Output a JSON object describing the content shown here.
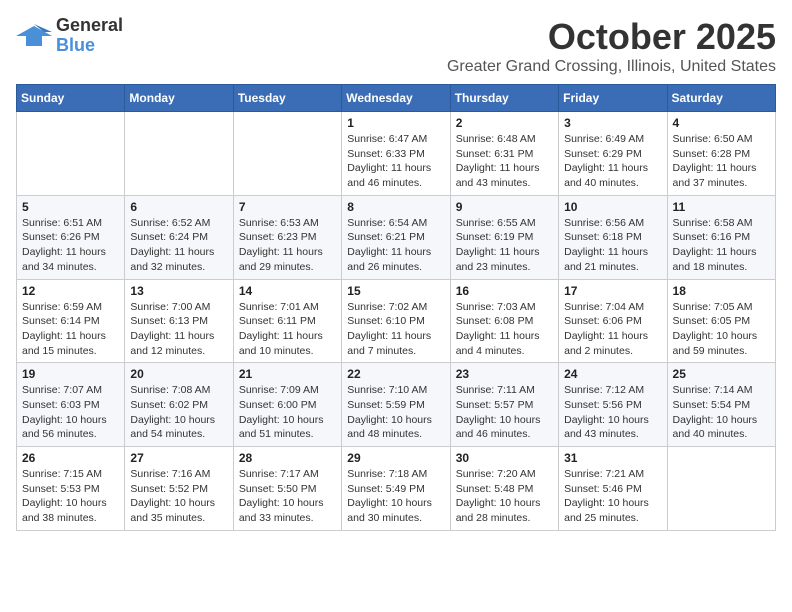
{
  "logo": {
    "line1": "General",
    "line2": "Blue"
  },
  "title": "October 2025",
  "location": "Greater Grand Crossing, Illinois, United States",
  "days_of_week": [
    "Sunday",
    "Monday",
    "Tuesday",
    "Wednesday",
    "Thursday",
    "Friday",
    "Saturday"
  ],
  "weeks": [
    [
      {
        "day": "",
        "content": ""
      },
      {
        "day": "",
        "content": ""
      },
      {
        "day": "",
        "content": ""
      },
      {
        "day": "1",
        "content": "Sunrise: 6:47 AM\nSunset: 6:33 PM\nDaylight: 11 hours and 46 minutes."
      },
      {
        "day": "2",
        "content": "Sunrise: 6:48 AM\nSunset: 6:31 PM\nDaylight: 11 hours and 43 minutes."
      },
      {
        "day": "3",
        "content": "Sunrise: 6:49 AM\nSunset: 6:29 PM\nDaylight: 11 hours and 40 minutes."
      },
      {
        "day": "4",
        "content": "Sunrise: 6:50 AM\nSunset: 6:28 PM\nDaylight: 11 hours and 37 minutes."
      }
    ],
    [
      {
        "day": "5",
        "content": "Sunrise: 6:51 AM\nSunset: 6:26 PM\nDaylight: 11 hours and 34 minutes."
      },
      {
        "day": "6",
        "content": "Sunrise: 6:52 AM\nSunset: 6:24 PM\nDaylight: 11 hours and 32 minutes."
      },
      {
        "day": "7",
        "content": "Sunrise: 6:53 AM\nSunset: 6:23 PM\nDaylight: 11 hours and 29 minutes."
      },
      {
        "day": "8",
        "content": "Sunrise: 6:54 AM\nSunset: 6:21 PM\nDaylight: 11 hours and 26 minutes."
      },
      {
        "day": "9",
        "content": "Sunrise: 6:55 AM\nSunset: 6:19 PM\nDaylight: 11 hours and 23 minutes."
      },
      {
        "day": "10",
        "content": "Sunrise: 6:56 AM\nSunset: 6:18 PM\nDaylight: 11 hours and 21 minutes."
      },
      {
        "day": "11",
        "content": "Sunrise: 6:58 AM\nSunset: 6:16 PM\nDaylight: 11 hours and 18 minutes."
      }
    ],
    [
      {
        "day": "12",
        "content": "Sunrise: 6:59 AM\nSunset: 6:14 PM\nDaylight: 11 hours and 15 minutes."
      },
      {
        "day": "13",
        "content": "Sunrise: 7:00 AM\nSunset: 6:13 PM\nDaylight: 11 hours and 12 minutes."
      },
      {
        "day": "14",
        "content": "Sunrise: 7:01 AM\nSunset: 6:11 PM\nDaylight: 11 hours and 10 minutes."
      },
      {
        "day": "15",
        "content": "Sunrise: 7:02 AM\nSunset: 6:10 PM\nDaylight: 11 hours and 7 minutes."
      },
      {
        "day": "16",
        "content": "Sunrise: 7:03 AM\nSunset: 6:08 PM\nDaylight: 11 hours and 4 minutes."
      },
      {
        "day": "17",
        "content": "Sunrise: 7:04 AM\nSunset: 6:06 PM\nDaylight: 11 hours and 2 minutes."
      },
      {
        "day": "18",
        "content": "Sunrise: 7:05 AM\nSunset: 6:05 PM\nDaylight: 10 hours and 59 minutes."
      }
    ],
    [
      {
        "day": "19",
        "content": "Sunrise: 7:07 AM\nSunset: 6:03 PM\nDaylight: 10 hours and 56 minutes."
      },
      {
        "day": "20",
        "content": "Sunrise: 7:08 AM\nSunset: 6:02 PM\nDaylight: 10 hours and 54 minutes."
      },
      {
        "day": "21",
        "content": "Sunrise: 7:09 AM\nSunset: 6:00 PM\nDaylight: 10 hours and 51 minutes."
      },
      {
        "day": "22",
        "content": "Sunrise: 7:10 AM\nSunset: 5:59 PM\nDaylight: 10 hours and 48 minutes."
      },
      {
        "day": "23",
        "content": "Sunrise: 7:11 AM\nSunset: 5:57 PM\nDaylight: 10 hours and 46 minutes."
      },
      {
        "day": "24",
        "content": "Sunrise: 7:12 AM\nSunset: 5:56 PM\nDaylight: 10 hours and 43 minutes."
      },
      {
        "day": "25",
        "content": "Sunrise: 7:14 AM\nSunset: 5:54 PM\nDaylight: 10 hours and 40 minutes."
      }
    ],
    [
      {
        "day": "26",
        "content": "Sunrise: 7:15 AM\nSunset: 5:53 PM\nDaylight: 10 hours and 38 minutes."
      },
      {
        "day": "27",
        "content": "Sunrise: 7:16 AM\nSunset: 5:52 PM\nDaylight: 10 hours and 35 minutes."
      },
      {
        "day": "28",
        "content": "Sunrise: 7:17 AM\nSunset: 5:50 PM\nDaylight: 10 hours and 33 minutes."
      },
      {
        "day": "29",
        "content": "Sunrise: 7:18 AM\nSunset: 5:49 PM\nDaylight: 10 hours and 30 minutes."
      },
      {
        "day": "30",
        "content": "Sunrise: 7:20 AM\nSunset: 5:48 PM\nDaylight: 10 hours and 28 minutes."
      },
      {
        "day": "31",
        "content": "Sunrise: 7:21 AM\nSunset: 5:46 PM\nDaylight: 10 hours and 25 minutes."
      },
      {
        "day": "",
        "content": ""
      }
    ]
  ]
}
